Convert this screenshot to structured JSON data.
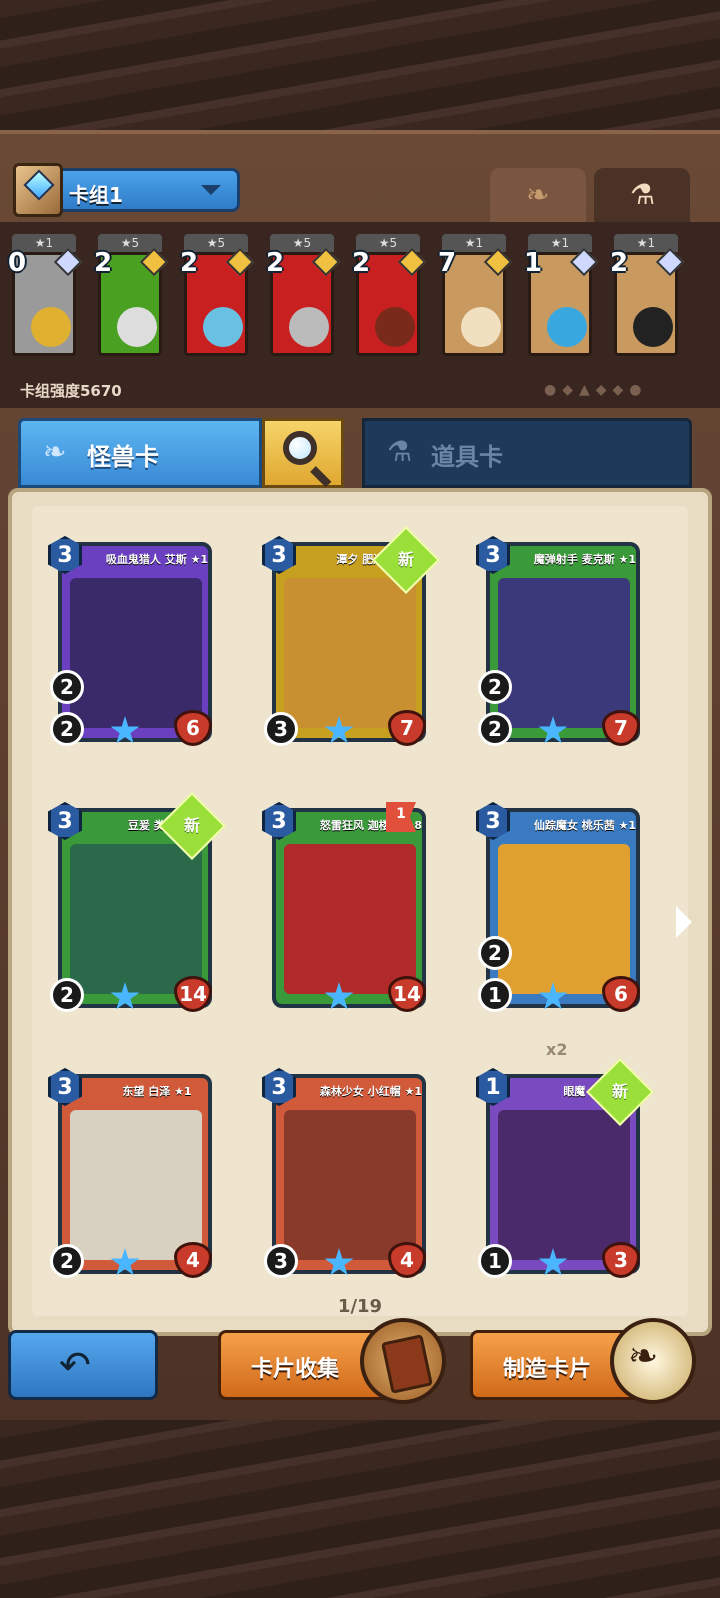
{
  "deck": {
    "name": "卡组1",
    "power_label": "卡组强度5670"
  },
  "top_tabs": {
    "monster_icon": "paw-icon",
    "item_icon": "potion-icon"
  },
  "deck_slots": [
    {
      "stars": "★1",
      "cost": "0",
      "bg": "#9a9a9a",
      "art": "#e0b030"
    },
    {
      "stars": "★5",
      "cost": "2",
      "bg": "#4aa020",
      "art": "#ddd"
    },
    {
      "stars": "★5",
      "cost": "2",
      "bg": "#c82020",
      "art": "#6ac0e0"
    },
    {
      "stars": "★5",
      "cost": "2",
      "bg": "#c82020",
      "art": "#bbb"
    },
    {
      "stars": "★5",
      "cost": "2",
      "bg": "#c82020",
      "art": "#7a2a1a"
    },
    {
      "stars": "★1",
      "cost": "7",
      "bg": "#c89a60",
      "art": "#f0e0c0"
    },
    {
      "stars": "★1",
      "cost": "1",
      "bg": "#c89a60",
      "art": "#3aa8e0"
    },
    {
      "stars": "★1",
      "cost": "2",
      "bg": "#c89a60",
      "art": "#222"
    }
  ],
  "tabs": {
    "monster": "怪兽卡",
    "item": "道具卡"
  },
  "cards": [
    {
      "title": "吸血鬼猎人 艾斯 ★1",
      "cost": "3",
      "atk": "2",
      "atk2": "2",
      "hp": "6",
      "art": "#3a2a6a",
      "frame": "#6a40c0",
      "new": ""
    },
    {
      "title": "潭夕 肥遗 ★1",
      "cost": "3",
      "atk": "3",
      "atk2": "",
      "hp": "7",
      "art": "#c89030",
      "frame": "#c8a020",
      "new": "新"
    },
    {
      "title": "魔弹射手 麦克斯 ★1",
      "cost": "3",
      "atk": "2",
      "atk2": "2",
      "hp": "7",
      "art": "#3a3a7a",
      "frame": "#3a9a3a",
      "new": ""
    },
    {
      "title": "豆爰 类 ★1",
      "cost": "3",
      "atk": "2",
      "atk2": "",
      "hp": "14",
      "art": "#2a6a4a",
      "frame": "#3a9a3a",
      "new": "新"
    },
    {
      "title": "怒雷狂风 迦楼罗 ★8",
      "cost": "3",
      "atk": "",
      "atk2": "",
      "hp": "14",
      "art": "#b02a2a",
      "frame": "#3a9a3a",
      "new": "",
      "flag": "1"
    },
    {
      "title": "仙踪魔女 桃乐茜 ★1",
      "cost": "3",
      "atk": "1",
      "atk2": "2",
      "hp": "6",
      "art": "#e0a030",
      "frame": "#3a7ac0",
      "new": ""
    },
    {
      "title": "东望 白泽 ★1",
      "cost": "3",
      "atk": "2",
      "atk2": "",
      "hp": "4",
      "art": "#d8d0c0",
      "frame": "#d05a3a",
      "new": ""
    },
    {
      "title": "森林少女 小红帽 ★1",
      "cost": "3",
      "atk": "3",
      "atk2": "",
      "hp": "4",
      "art": "#8a3a2a",
      "frame": "#d05a3a",
      "new": ""
    },
    {
      "title": "眼魔 ★1",
      "cost": "1",
      "atk": "1",
      "atk2": "",
      "hp": "3",
      "art": "#4a2a6a",
      "frame": "#7a4ac0",
      "new": "新",
      "mult": "x2"
    }
  ],
  "page": "1/19",
  "buttons": {
    "collect": "卡片收集",
    "craft": "制造卡片"
  }
}
